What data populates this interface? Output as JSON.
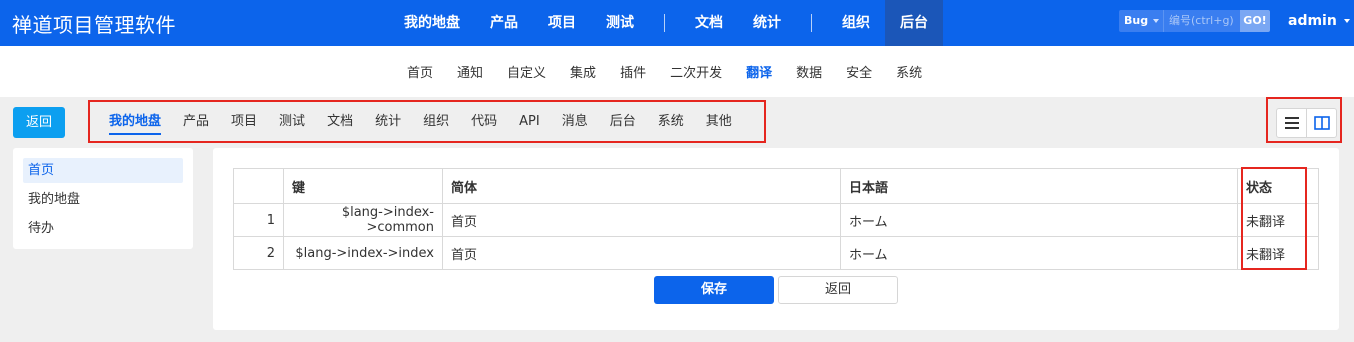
{
  "header": {
    "brand": "禅道项目管理软件",
    "nav": [
      "我的地盘",
      "产品",
      "项目",
      "测试",
      "文档",
      "统计",
      "组织",
      "后台"
    ],
    "search": {
      "object": "Bug",
      "placeholder": "编号(ctrl+g)",
      "go": "GO!"
    },
    "user": "admin"
  },
  "subnav": [
    "首页",
    "通知",
    "自定义",
    "集成",
    "插件",
    "二次开发",
    "翻译",
    "数据",
    "安全",
    "系统"
  ],
  "toolbar": {
    "back": "返回",
    "modules": [
      "我的地盘",
      "产品",
      "项目",
      "测试",
      "文档",
      "统计",
      "组织",
      "代码",
      "API",
      "消息",
      "后台",
      "系统",
      "其他"
    ]
  },
  "side": [
    "首页",
    "我的地盘",
    "待办"
  ],
  "table": {
    "headers": [
      "",
      "键",
      "简体",
      "日本語",
      "状态"
    ],
    "rows": [
      {
        "num": "1",
        "key": "$lang->index->common",
        "zh": "首页",
        "ja": "ホーム",
        "status": "未翻译"
      },
      {
        "num": "2",
        "key": "$lang->index->index",
        "zh": "首页",
        "ja": "ホーム",
        "status": "未翻译"
      }
    ]
  },
  "actions": {
    "save": "保存",
    "back": "返回"
  },
  "icons": {
    "list_view": "list-icon",
    "split_view": "columns-icon"
  },
  "colors": {
    "header": "#0c64eb",
    "accent": "#0c9ff0",
    "highlight": "#e5261f"
  }
}
